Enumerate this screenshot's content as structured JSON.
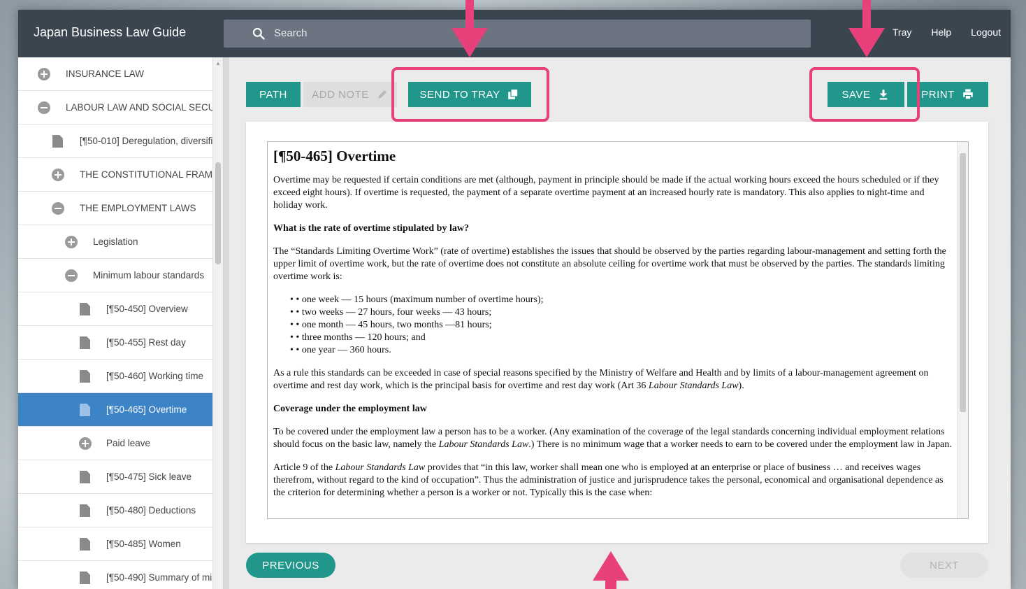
{
  "header": {
    "app_title": "Japan Business Law Guide",
    "search_placeholder": "Search",
    "links": [
      "Tray",
      "Help",
      "Logout"
    ]
  },
  "sidebar": {
    "items": [
      {
        "label": "INSURANCE LAW",
        "icon": "plus-circle-icon"
      },
      {
        "label": "LABOUR LAW AND SOCIAL SECUR",
        "icon": "minus-circle-icon"
      },
      {
        "label": "[¶50-010] Deregulation, diversifi",
        "icon": "document-icon"
      },
      {
        "label": "THE CONSTITUTIONAL FRAME",
        "icon": "plus-circle-icon"
      },
      {
        "label": "THE EMPLOYMENT LAWS",
        "icon": "minus-circle-icon"
      },
      {
        "label": "Legislation",
        "icon": "plus-circle-icon"
      },
      {
        "label": "Minimum labour standards",
        "icon": "minus-circle-icon"
      },
      {
        "label": "[¶50-450] Overview",
        "icon": "document-icon"
      },
      {
        "label": "[¶50-455] Rest day",
        "icon": "document-icon"
      },
      {
        "label": "[¶50-460] Working time",
        "icon": "document-icon"
      },
      {
        "label": "[¶50-465] Overtime",
        "icon": "document-icon",
        "active": true
      },
      {
        "label": "Paid leave",
        "icon": "plus-circle-icon"
      },
      {
        "label": "[¶50-475] Sick leave",
        "icon": "document-icon"
      },
      {
        "label": "[¶50-480] Deductions",
        "icon": "document-icon"
      },
      {
        "label": "[¶50-485] Women",
        "icon": "document-icon"
      },
      {
        "label": "[¶50-490] Summary of mi",
        "icon": "document-icon"
      }
    ]
  },
  "toolbar": {
    "path_label": "PATH",
    "add_note_label": "ADD NOTE",
    "send_to_tray_label": "SEND TO TRAY",
    "save_label": "SAVE",
    "print_label": "PRINT"
  },
  "document": {
    "title": "[¶50-465] Overtime",
    "para1": "Overtime may be requested if certain conditions are met (although, payment in principle should be made if the actual working hours exceed the hours scheduled or if they exceed eight hours). If overtime is requested, the payment of a separate overtime payment at an increased hourly rate is mandatory. This also applies to night-time and holiday work.",
    "heading1": "What is the rate of overtime stipulated by law?",
    "para2": "The “Standards Limiting Overtime Work” (rate of overtime) establishes the issues that should be observed by the parties regarding labour-management and setting forth the upper limit of overtime work, but the rate of overtime does not constitute an absolute ceiling for overtime work that must be observed by the parties. The standards limiting overtime work is:",
    "list": [
      "one week — 15 hours (maximum number of overtime hours);",
      "two weeks — 27 hours, four weeks — 43 hours;",
      "one month — 45 hours, two months —81 hours;",
      "three months — 120 hours; and",
      "one year — 360 hours."
    ],
    "para3_start": "As a rule this standards can be exceeded in case of special reasons specified by the Ministry of Welfare and Health and by limits of a labour-management agreement on overtime and rest day work, which is the principal basis for overtime and rest day work (Art 36 ",
    "para3_italic": "Labour Standards Law",
    "para3_end": ").",
    "heading2": "Coverage under the employment law",
    "para4_start": "To be covered under the employment law a person has to be a worker. (Any examination of the coverage of the legal standards concerning individual employment relations should focus on the basic law, namely the ",
    "para4_italic": "Labour Standards Law",
    "para4_end": ".) There is no minimum wage that a worker needs to earn to be covered under the employment law in Japan.",
    "para5_start": "Article 9 of the ",
    "para5_italic": "Labour Standards Law",
    "para5_end": " provides that “in this law, worker shall mean one who is employed at an enterprise or place of business … and receives wages therefrom, without regard to the kind of occupation”. Thus the administration of justice and jurisprudence takes the personal, economical and organisational dependence as the criterion for determining whether a person is a worker or not. Typically this is the case when:"
  },
  "pager": {
    "previous_label": "PREVIOUS",
    "next_label": "NEXT"
  },
  "colors": {
    "topbar": "#3b4550",
    "accent": "#21968a",
    "active": "#3c84c6",
    "highlight": "#e8407a"
  }
}
